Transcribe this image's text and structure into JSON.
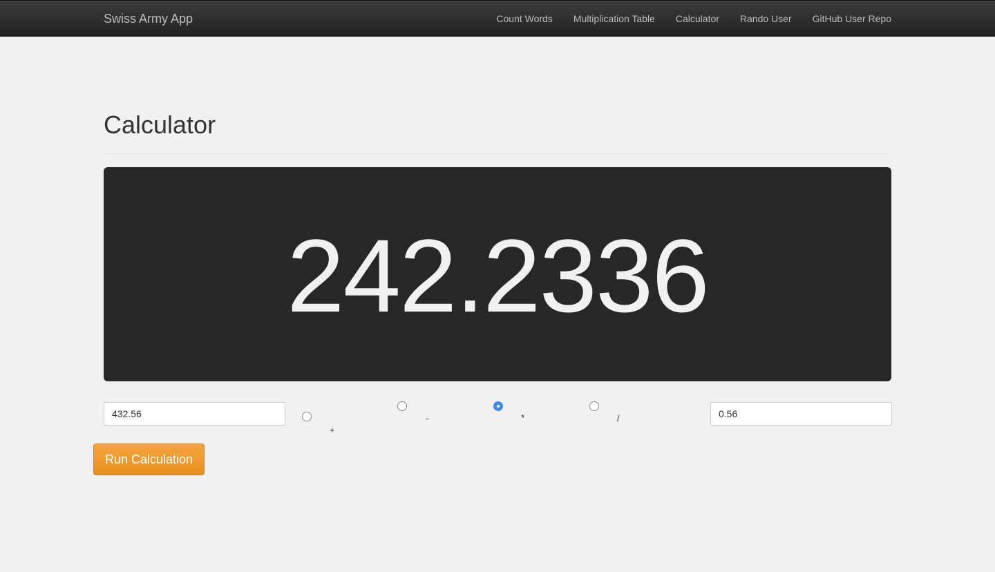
{
  "navbar": {
    "brand": "Swiss Army App",
    "links": [
      "Count Words",
      "Multiplication Table",
      "Calculator",
      "Rando User",
      "GitHub User Repo"
    ]
  },
  "page": {
    "title": "Calculator"
  },
  "display": {
    "result": "242.2336"
  },
  "inputs": {
    "first_value": "432.56",
    "second_value": "0.56"
  },
  "operations": [
    {
      "symbol": "+",
      "checked": false
    },
    {
      "symbol": "-",
      "checked": false
    },
    {
      "symbol": "*",
      "checked": true
    },
    {
      "symbol": "/",
      "checked": false
    }
  ],
  "run_button": {
    "label": "Run Calculation"
  },
  "colors": {
    "accent": "#3b8de6",
    "button": "#f0a030",
    "display_bg": "#272727"
  }
}
